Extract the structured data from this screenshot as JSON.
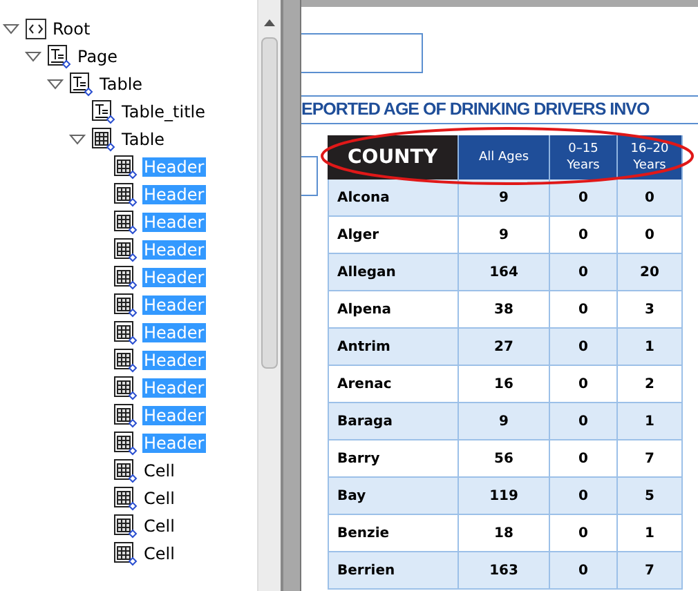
{
  "tree": [
    {
      "label": "Root",
      "kind": "root",
      "expanded": true,
      "selected": false,
      "children": [
        {
          "label": "Page",
          "kind": "text",
          "expanded": true,
          "selected": false,
          "children": [
            {
              "label": "Table",
              "kind": "text",
              "expanded": true,
              "selected": false,
              "children": [
                {
                  "label": "Table_title",
                  "kind": "text",
                  "selected": false
                },
                {
                  "label": "Table",
                  "kind": "table",
                  "expanded": true,
                  "selected": false,
                  "children": [
                    {
                      "label": "Header",
                      "kind": "table",
                      "selected": true
                    },
                    {
                      "label": "Header",
                      "kind": "table",
                      "selected": true
                    },
                    {
                      "label": "Header",
                      "kind": "table",
                      "selected": true
                    },
                    {
                      "label": "Header",
                      "kind": "table",
                      "selected": true
                    },
                    {
                      "label": "Header",
                      "kind": "table",
                      "selected": true
                    },
                    {
                      "label": "Header",
                      "kind": "table",
                      "selected": true
                    },
                    {
                      "label": "Header",
                      "kind": "table",
                      "selected": true
                    },
                    {
                      "label": "Header",
                      "kind": "table",
                      "selected": true
                    },
                    {
                      "label": "Header",
                      "kind": "table",
                      "selected": true
                    },
                    {
                      "label": "Header",
                      "kind": "table",
                      "selected": true
                    },
                    {
                      "label": "Header",
                      "kind": "table",
                      "selected": true
                    },
                    {
                      "label": "Cell",
                      "kind": "table",
                      "selected": false
                    },
                    {
                      "label": "Cell",
                      "kind": "table",
                      "selected": false
                    },
                    {
                      "label": "Cell",
                      "kind": "table",
                      "selected": false
                    },
                    {
                      "label": "Cell",
                      "kind": "table",
                      "selected": false
                    }
                  ]
                }
              ]
            }
          ]
        }
      ]
    }
  ],
  "document": {
    "title": "EPORTED AGE OF DRINKING DRIVERS INVO",
    "table": {
      "columns": [
        {
          "label": "COUNTY",
          "kind": "dark"
        },
        {
          "label": "All Ages",
          "kind": "blue"
        },
        {
          "label": "0–15 Years",
          "kind": "blue"
        },
        {
          "label": "16–20 Years",
          "kind": "blue"
        }
      ],
      "rows": [
        [
          "Alcona",
          "9",
          "0",
          "0"
        ],
        [
          "Alger",
          "9",
          "0",
          "0"
        ],
        [
          "Allegan",
          "164",
          "0",
          "20"
        ],
        [
          "Alpena",
          "38",
          "0",
          "3"
        ],
        [
          "Antrim",
          "27",
          "0",
          "1"
        ],
        [
          "Arenac",
          "16",
          "0",
          "2"
        ],
        [
          "Baraga",
          "9",
          "0",
          "1"
        ],
        [
          "Barry",
          "56",
          "0",
          "7"
        ],
        [
          "Bay",
          "119",
          "0",
          "5"
        ],
        [
          "Benzie",
          "18",
          "0",
          "1"
        ],
        [
          "Berrien",
          "163",
          "0",
          "7"
        ]
      ]
    }
  }
}
